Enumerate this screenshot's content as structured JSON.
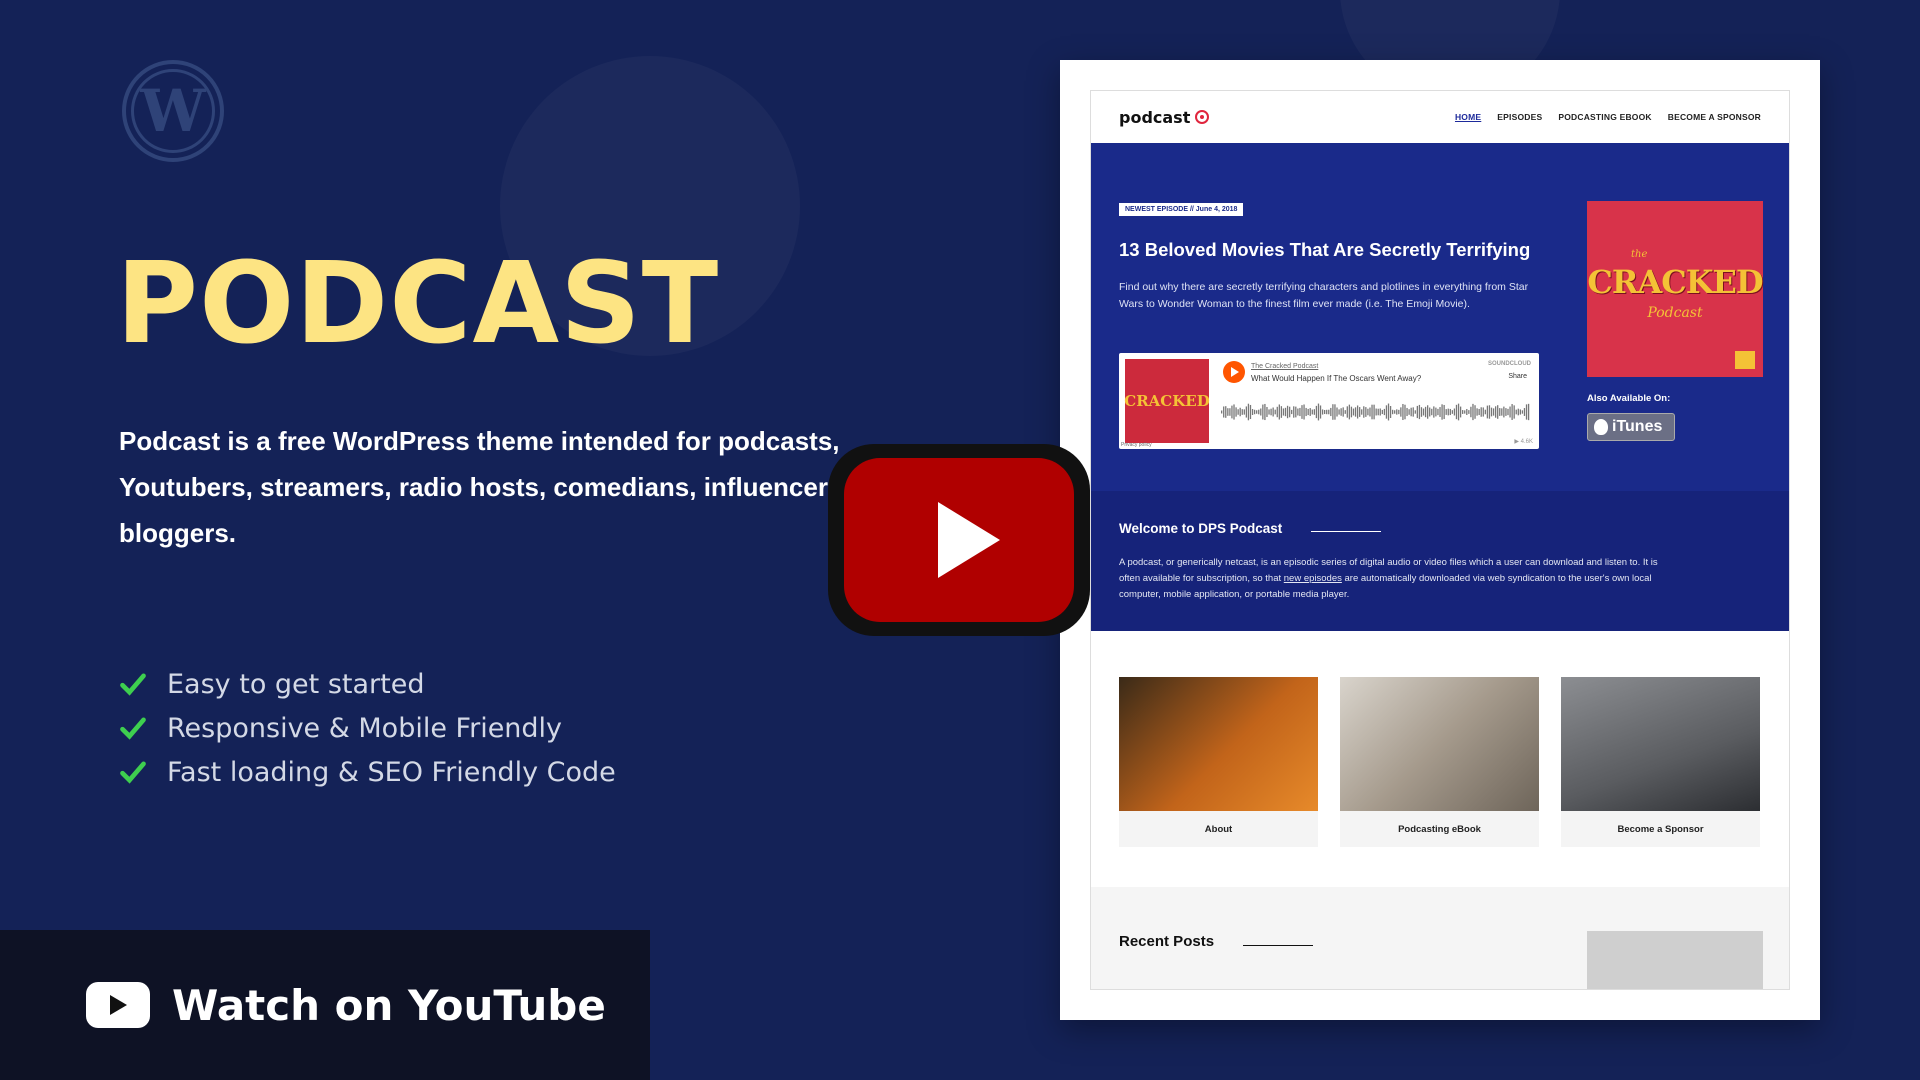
{
  "hero": {
    "title": "PODCAST",
    "description": "Podcast is a free WordPress theme intended for podcasts, Youtubers, streamers, radio hosts, comedians, influencers bloggers.",
    "features": [
      "Easy to get started",
      "Responsive & Mobile Friendly",
      "Fast loading & SEO Friendly Code"
    ]
  },
  "wordpress_logo_icon": "wordpress-icon",
  "youtube": {
    "watch_label": "Watch on YouTube",
    "accent": "#b00000"
  },
  "colors": {
    "background": "#142257",
    "title": "#fde483",
    "check": "#3ecf4f",
    "site_blue": "#1a2a8a"
  },
  "site": {
    "logo_text": "podcast",
    "nav": [
      "HOME",
      "EPISODES",
      "PODCASTING EBOOK",
      "BECOME A SPONSOR"
    ],
    "episode_tag": "NEWEST EPISODE   //   June 4, 2018",
    "episode_title": "13 Beloved Movies That Are Secretly Terrifying",
    "episode_desc": "Find out why there are secretly terrifying characters and plotlines in everything from Star Wars to Wonder Woman to the finest film ever made (i.e. The Emoji Movie).",
    "player": {
      "art_text": "CRACKED",
      "podcast_name": "The Cracked Podcast",
      "track": "What Would Happen If The Oscars Went Away?",
      "brand": "SOUNDCLOUD",
      "share": "Share",
      "privacy": "Privacy policy",
      "plays": "▶ 4.6K"
    },
    "cover": {
      "the": "the",
      "title": "CRACKED",
      "sub": "Podcast"
    },
    "also_available": "Also Available On:",
    "itunes_label": "iTunes",
    "welcome_title": "Welcome to DPS Podcast",
    "welcome_text_1": "A podcast, or generically netcast, is an episodic series of digital audio or video files which a user can download and listen to. It is often available for subscription, so that ",
    "welcome_link": "new episodes",
    "welcome_text_2": " are automatically downloaded via web syndication to the user's own local computer, mobile application, or portable media player.",
    "cards": [
      "About",
      "Podcasting eBook",
      "Become a Sponsor"
    ],
    "recent_title": "Recent Posts"
  }
}
